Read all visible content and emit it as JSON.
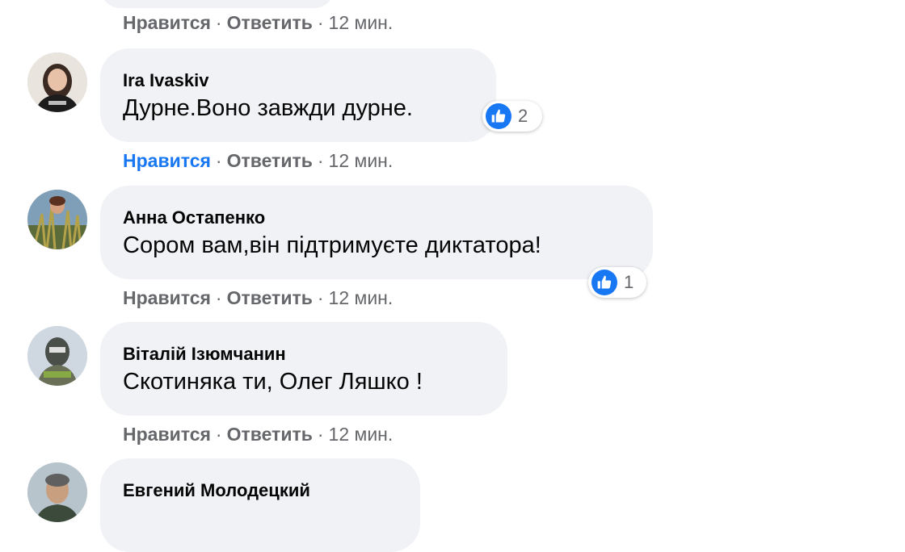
{
  "comments": [
    {
      "name": "",
      "text": "",
      "like_label": "Нравится",
      "reply_label": "Ответить",
      "time": "12 мин.",
      "liked": false
    },
    {
      "name": "Ira Ivaskiv",
      "text": "Дурне.Воно завжди дурне.",
      "like_label": "Нравится",
      "reply_label": "Ответить",
      "time": "12 мин.",
      "liked": true,
      "reaction_count": "2"
    },
    {
      "name": "Анна Остапенко",
      "text": "Сором вам,він підтримуєте диктатора!",
      "like_label": "Нравится",
      "reply_label": "Ответить",
      "time": "12 мин.",
      "liked": false,
      "reaction_count": "1"
    },
    {
      "name": "Віталій Ізюмчанин",
      "text": "Скотиняка ти, Олег Ляшко !",
      "like_label": "Нравится",
      "reply_label": "Ответить",
      "time": "12 мин.",
      "liked": false
    },
    {
      "name": "Евгений Молодецкий",
      "text": ""
    }
  ],
  "separator": "·",
  "colors": {
    "bubble": "#f0f2f5",
    "meta": "#65676b",
    "accent": "#1877f2"
  }
}
